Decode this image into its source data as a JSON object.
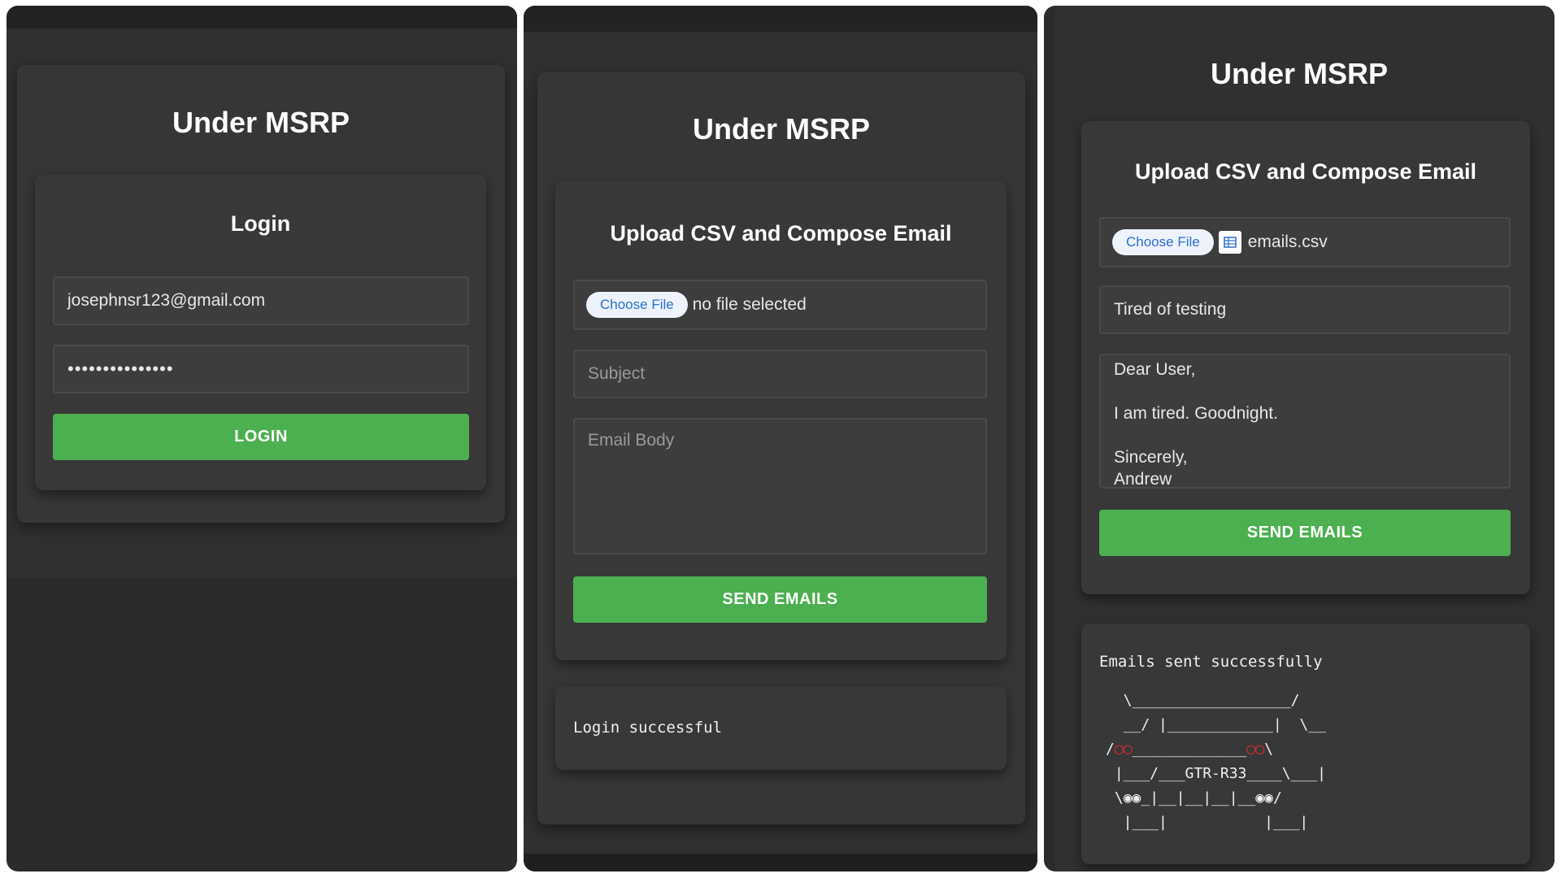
{
  "app": {
    "title": "Under MSRP"
  },
  "login_screen": {
    "heading": "Login",
    "email_value": "josephnsr123@gmail.com",
    "password_mask": "•••••••••••••••",
    "login_button": "LOGIN"
  },
  "compose_empty": {
    "heading": "Upload CSV and Compose Email",
    "choose_file_button": "Choose File",
    "file_status": "no file selected",
    "subject_placeholder": "Subject",
    "body_placeholder": "Email Body",
    "send_button": "SEND EMAILS",
    "status_message": "Login successful"
  },
  "compose_filled": {
    "heading": "Upload CSV and Compose Email",
    "choose_file_button": "Choose File",
    "file_name": "emails.csv",
    "file_icon": "spreadsheet-icon",
    "subject_value": "Tired of testing",
    "body_lines": [
      "Dear User,",
      "",
      "I am tired. Goodnight.",
      "",
      "Sincerely,",
      "Andrew"
    ],
    "send_button": "SEND EMAILS",
    "status_message": "Emails sent successfully",
    "ascii_art": {
      "line1": "  \\__________________/",
      "line2": "  __/ |____________|  \\__",
      "line3_left": "/",
      "line3_mid": "_____________",
      "line3_right": "\\",
      "line4": " |___/___GTR-R33____\\___|",
      "line5_left": " \\",
      "line5_mid": "_|__|__|__|__",
      "line5_right": "/",
      "line6": "  |___|           |___|",
      "lamp_glyph": "◯◯",
      "wheel_glyph": "◉◉"
    }
  },
  "colors": {
    "background": "#2b2b2b",
    "card": "#363636",
    "accent_green": "#4caf50",
    "file_button_text": "#2b6fd6",
    "headlight_red": "#d32f2f"
  }
}
